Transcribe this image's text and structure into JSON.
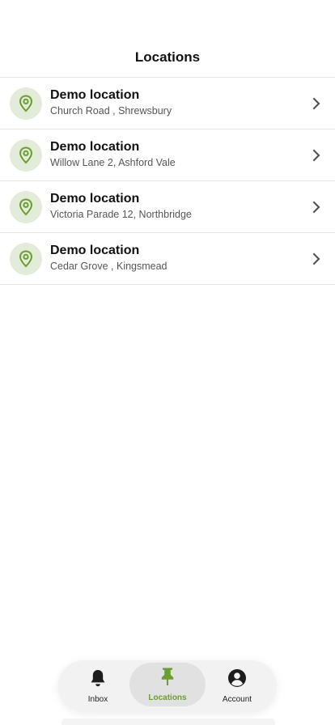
{
  "header": {
    "title": "Locations"
  },
  "locations": [
    {
      "name": "Demo location",
      "address": "Church Road , Shrewsbury"
    },
    {
      "name": "Demo location",
      "address": "Willow Lane 2, Ashford Vale"
    },
    {
      "name": "Demo location",
      "address": "Victoria Parade 12, Northbridge"
    },
    {
      "name": "Demo location",
      "address": "Cedar Grove , Kingsmead"
    }
  ],
  "tabbar": {
    "inbox_label": "Inbox",
    "locations_label": "Locations",
    "account_label": "Account",
    "active_tab": "Locations"
  },
  "colors": {
    "accent": "#6a9e2f",
    "pin_bg": "#e2ecd8"
  },
  "icons": [
    "map-pin-icon",
    "chevron-right-icon",
    "bell-icon",
    "pushpin-icon",
    "user-icon"
  ]
}
